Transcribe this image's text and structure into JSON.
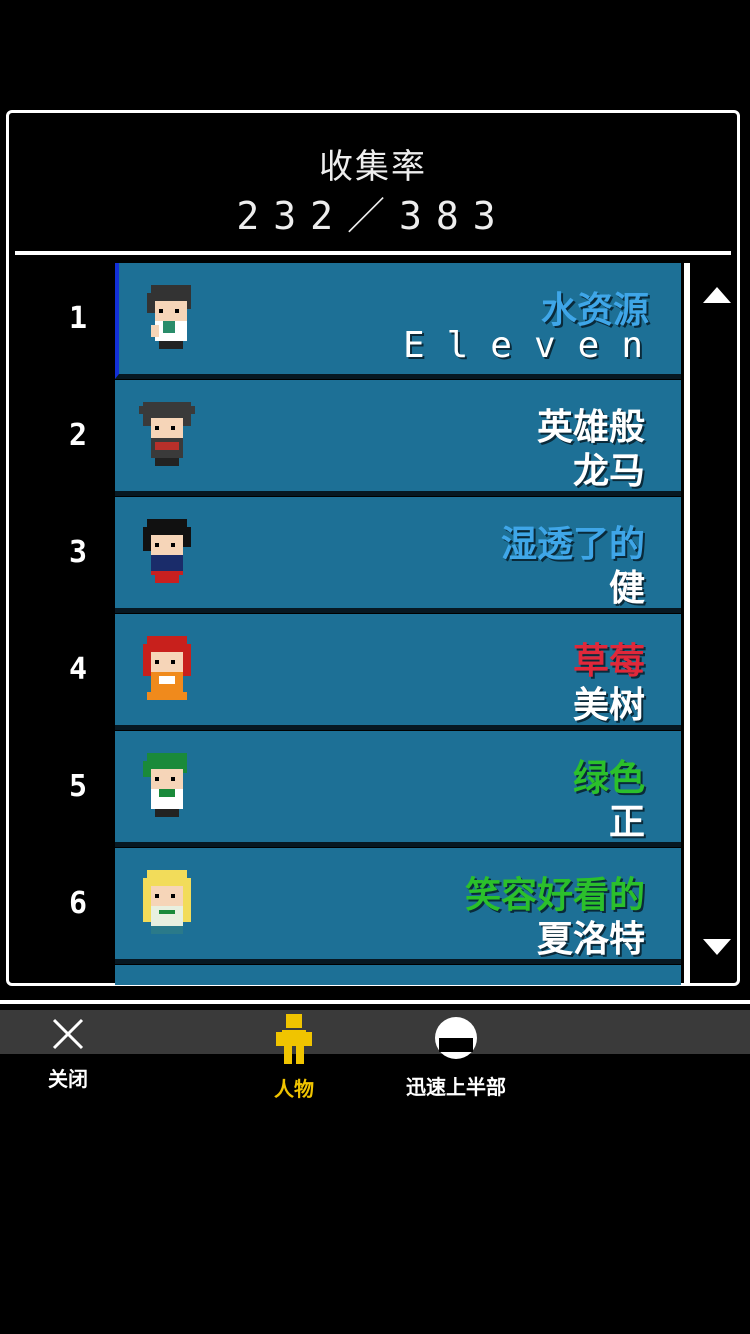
{
  "header": {
    "title": "收集率",
    "count": "232／383"
  },
  "list": [
    {
      "rank": "1",
      "name1": "水资源",
      "name2": "Eleven",
      "name1_color": "#3fa6e8",
      "avatar": "boy-dark-hair"
    },
    {
      "rank": "2",
      "name1": "英雄般",
      "name2": "龙马",
      "name1_color": "#ffffff",
      "avatar": "boy-spiky-hair"
    },
    {
      "rank": "3",
      "name1": "湿透了的",
      "name2": "健",
      "name1_color": "#3fa6e8",
      "avatar": "boy-black-hair"
    },
    {
      "rank": "4",
      "name1": "草莓",
      "name2": "美树",
      "name1_color": "#e0283a",
      "avatar": "girl-red-hair"
    },
    {
      "rank": "5",
      "name1": "绿色",
      "name2": "正",
      "name1_color": "#2bc02b",
      "avatar": "boy-green-hair"
    },
    {
      "rank": "6",
      "name1": "笑容好看的",
      "name2": "夏洛特",
      "name1_color": "#2bc02b",
      "avatar": "girl-blonde-hair"
    }
  ],
  "tabs": [
    {
      "label": "关闭",
      "icon": "close-icon",
      "color": "#ffffff"
    },
    {
      "label": "人物",
      "icon": "person-icon",
      "color": "#f0c400"
    },
    {
      "label": "迅速上半部",
      "icon": "ball-icon",
      "color": "#ffffff"
    }
  ]
}
